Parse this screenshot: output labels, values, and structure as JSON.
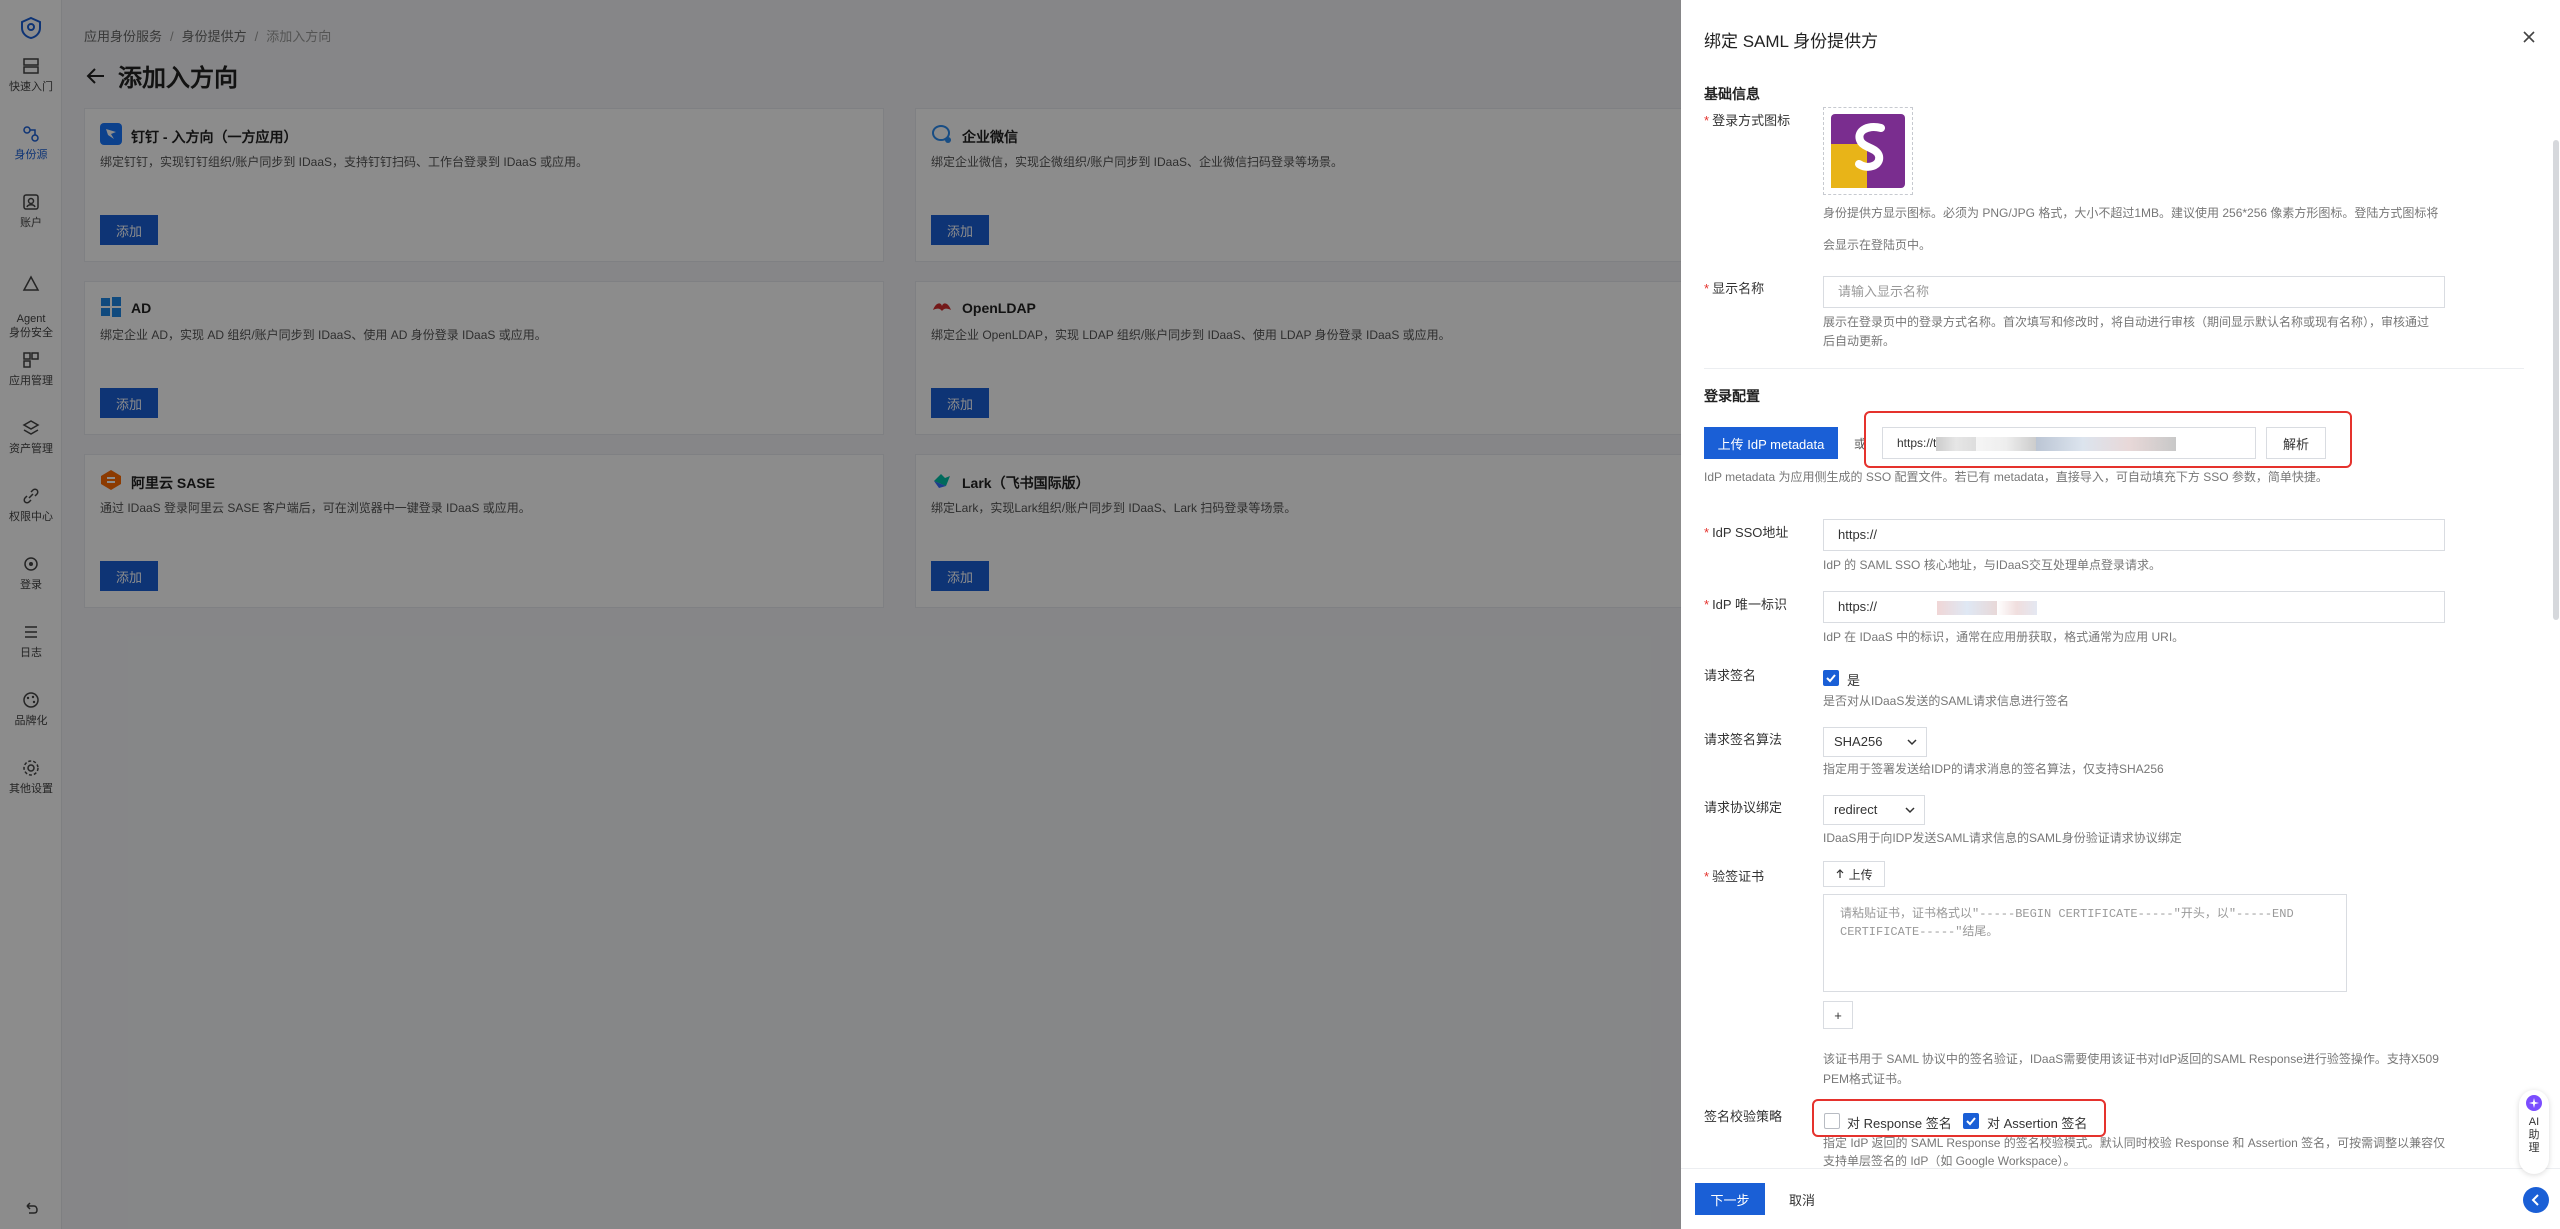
{
  "rail": {
    "items": [
      {
        "label": "快速入门",
        "icon": "dashboard-icon"
      },
      {
        "label": "身份源",
        "icon": "identity-source-icon",
        "active": true
      },
      {
        "label": "账户",
        "icon": "account-icon"
      },
      {
        "label": "Agent\n身份安全",
        "icon": "agent-icon"
      },
      {
        "label": "应用管理",
        "icon": "apps-icon"
      },
      {
        "label": "资产管理",
        "icon": "assets-icon"
      },
      {
        "label": "权限中心",
        "icon": "permission-icon"
      },
      {
        "label": "登录",
        "icon": "login-icon"
      },
      {
        "label": "日志",
        "icon": "log-icon"
      },
      {
        "label": "品牌化",
        "icon": "brand-icon"
      },
      {
        "label": "其他设置",
        "icon": "settings-icon"
      }
    ]
  },
  "breadcrumb": [
    "应用身份服务",
    "身份提供方",
    "添加入方向"
  ],
  "page_title": "添加入方向",
  "cards": [
    {
      "name": "钉钉 - 入方向（一方应用）",
      "desc": "绑定钉钉，实现钉钉组织/账户同步到 IDaaS，支持钉钉扫码、工作台登录到 IDaaS 或应用。",
      "button": "添加"
    },
    {
      "name": "企业微信",
      "desc": "绑定企业微信，实现企微组织/账户同步到 IDaaS、企业微信扫码登录等场景。",
      "button": "添加"
    },
    {
      "name": "AD",
      "desc": "绑定企业 AD，实现 AD 组织/账户同步到 IDaaS、使用 AD 身份登录 IDaaS 或应用。",
      "button": "添加"
    },
    {
      "name": "OpenLDAP",
      "desc": "绑定企业 OpenLDAP，实现 LDAP 组织/账户同步到 IDaaS、使用 LDAP 身份登录 IDaaS 或应用。",
      "button": "添加"
    },
    {
      "name": "阿里云 SASE",
      "desc": "通过 IDaaS 登录阿里云 SASE 客户端后，可在浏览器中一键登录 IDaaS 或应用。",
      "button": "添加"
    },
    {
      "name": "Lark（飞书国际版）",
      "desc": "绑定Lark，实现Lark组织/账户同步到 IDaaS、Lark 扫码登录等场景。",
      "button": "添加"
    }
  ],
  "drawer": {
    "title": "绑定 SAML 身份提供方",
    "section_basic": "基础信息",
    "icon_label": "登录方式图标",
    "icon_help_1": "身份提供方显示图标。必须为 PNG/JPG 格式，大小不超过1MB。建议使用 256*256 像素方形图标。登陆方式图标将",
    "icon_help_2": "会显示在登陆页中。",
    "display_name_label": "显示名称",
    "display_name_placeholder": "请输入显示名称",
    "display_name_help_1": "展示在登录页中的登录方式名称。首次填写和修改时，将自动进行审核（期间显示默认名称或现有名称），审核通过",
    "display_name_help_2": "后自动更新。",
    "section_login": "登录配置",
    "upload_metadata": "上传 IdP metadata",
    "or": "或",
    "metadata_url": "https://t",
    "parse": "解析",
    "metadata_help": "IdP metadata 为应用侧生成的 SSO 配置文件。若已有 metadata，直接导入，可自动填充下方 SSO 参数，简单快捷。",
    "sso_label": "IdP SSO地址",
    "sso_value": "https://",
    "sso_help": "IdP 的 SAML SSO 核心地址，与IDaaS交互处理单点登录请求。",
    "entity_label": "IdP 唯一标识",
    "entity_value": "https://",
    "entity_help": "IdP 在 IDaaS 中的标识，通常在应用册获取，格式通常为应用 URI。",
    "sign_req_label": "请求签名",
    "sign_req_value": "是",
    "sign_req_help": "是否对从IDaaS发送的SAML请求信息进行签名",
    "sign_alg_label": "请求签名算法",
    "sign_alg_value": "SHA256",
    "sign_alg_help": "指定用于签署发送给IDP的请求消息的签名算法，仅支持SHA256",
    "binding_label": "请求协议绑定",
    "binding_value": "redirect",
    "binding_help": "IDaaS用于向IDP发送SAML请求信息的SAML身份验证请求协议绑定",
    "cert_label": "验签证书",
    "cert_upload": "上传",
    "cert_placeholder": "请粘贴证书，证书格式以\"-----BEGIN CERTIFICATE-----\"开头，以\"-----END CERTIFICATE-----\"结尾。",
    "cert_add": "+",
    "cert_help_1": "该证书用于 SAML 协议中的签名验证，IDaaS需要使用该证书对IdP返回的SAML Response进行验签操作。支持X509",
    "cert_help_2": "PEM格式证书。",
    "policy_label": "签名校验策略",
    "policy_response": "对 Response 签名",
    "policy_assertion": "对 Assertion 签名",
    "policy_help_1": "指定 IdP 返回的 SAML Response 的签名校验模式。默认同时校验 Response 和 Assertion 签名，可按需调整以兼容仅",
    "policy_help_2": "支持单层签名的 IdP（如 Google Workspace）。",
    "next": "下一步",
    "cancel": "取消"
  },
  "ai_assistant": "AI\n助\n理"
}
